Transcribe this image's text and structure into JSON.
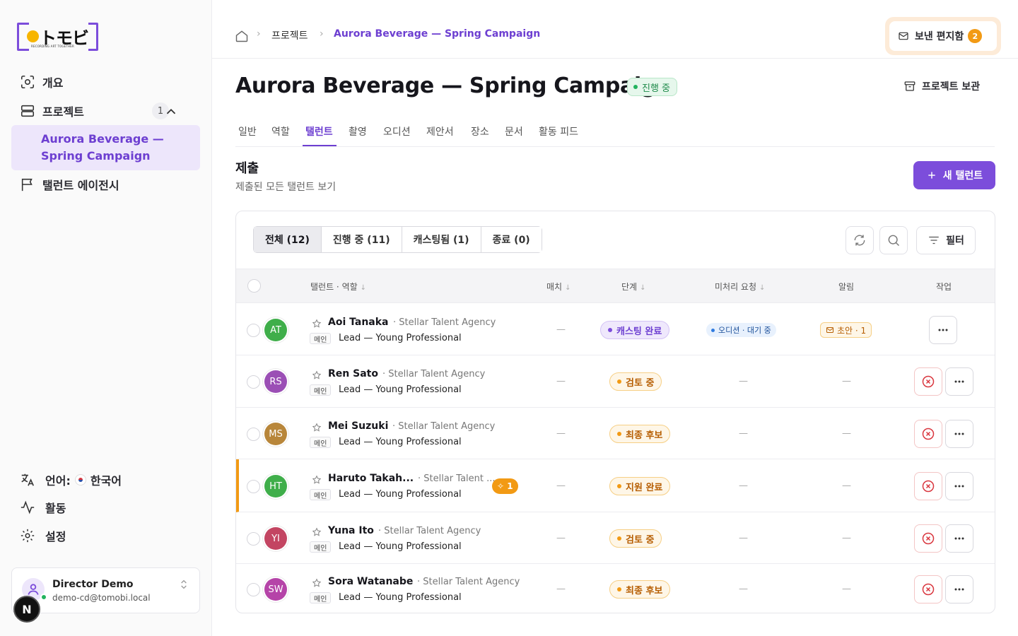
{
  "brand": {
    "logo_text": "トモビ",
    "tagline": "RECORDING ART TOGETHER"
  },
  "sidebar": {
    "items": [
      {
        "label": "개요",
        "icon": "overview-scan-icon"
      },
      {
        "label": "프로젝트",
        "icon": "projects-icon",
        "count": "1"
      },
      {
        "label": "탤런트 에이전시",
        "icon": "flag-icon"
      }
    ],
    "active_project": "Aurora Beverage — Spring Campaign",
    "footer": {
      "language_label": "언어:",
      "language_value": "한국어",
      "activity": "활동",
      "settings": "설정"
    },
    "user": {
      "name": "Director Demo",
      "email": "demo-cd@tomobi.local"
    },
    "dev_badge": "N"
  },
  "breadcrumb": {
    "projects": "프로젝트",
    "current": "Aurora Beverage — Spring Campaign"
  },
  "outbox": {
    "label": "보낸 편지함",
    "count": "2"
  },
  "page": {
    "title": "Aurora Beverage — Spring Campaign",
    "status": "진행 중",
    "archive_label": "프로젝트 보관"
  },
  "tabs": [
    "일반",
    "역할",
    "탤런트",
    "촬영",
    "오디션",
    "제안서",
    "장소",
    "문서",
    "활동 피드"
  ],
  "active_tab": "탤런트",
  "section": {
    "title": "제출",
    "subtitle": "제출된 모든 탤런트 보기",
    "new_button": "새 탤런트"
  },
  "filters": {
    "segments": [
      "전체 (12)",
      "진행 중 (11)",
      "캐스팅됨 (1)",
      "종료 (0)"
    ],
    "active": "전체 (12)",
    "filter_label": "필터"
  },
  "table": {
    "headers": {
      "talent": "탤런트 · 역할",
      "match": "매치",
      "stage": "단계",
      "pending": "미처리 요청",
      "alerts": "알림",
      "actions": "작업"
    },
    "main_tag": "메인",
    "empty": "—",
    "rows": [
      {
        "initials": "AT",
        "color": "#3fae4a",
        "name": "Aoi Tanaka",
        "agency": "· Stellar Talent Agency",
        "role": "Lead — Young Professional",
        "stage": "캐스팅 완료",
        "stage_tone": "purple",
        "pending": "오디션 · 대기 중",
        "alert": "초안 · 1"
      },
      {
        "initials": "RS",
        "color": "#9b4fb5",
        "name": "Ren Sato",
        "agency": "· Stellar Talent Agency",
        "role": "Lead — Young Professional",
        "stage": "검토 중",
        "stage_tone": "amber"
      },
      {
        "initials": "MS",
        "color": "#b8863a",
        "name": "Mei Suzuki",
        "agency": "· Stellar Talent Agency",
        "role": "Lead — Young Professional",
        "stage": "최종 후보",
        "stage_tone": "amber"
      },
      {
        "initials": "HT",
        "color": "#3fae4a",
        "name": "Haruto Takah...",
        "agency": "· Stellar Talent ...",
        "role": "Lead — Young Professional",
        "stage": "지원 완료",
        "stage_tone": "amber",
        "match_badge": "1",
        "flagged": true
      },
      {
        "initials": "YI",
        "color": "#c34562",
        "name": "Yuna Ito",
        "agency": "· Stellar Talent Agency",
        "role": "Lead — Young Professional",
        "stage": "검토 중",
        "stage_tone": "amber"
      },
      {
        "initials": "SW",
        "color": "#b544a8",
        "name": "Sora Watanabe",
        "agency": "· Stellar Talent Agency",
        "role": "Lead — Young Professional",
        "stage": "최종 후보",
        "stage_tone": "amber"
      }
    ]
  },
  "colors": {
    "accent": "#7c4ddb",
    "warning": "#f29a14",
    "success": "#22b35e",
    "danger": "#d9363e"
  }
}
